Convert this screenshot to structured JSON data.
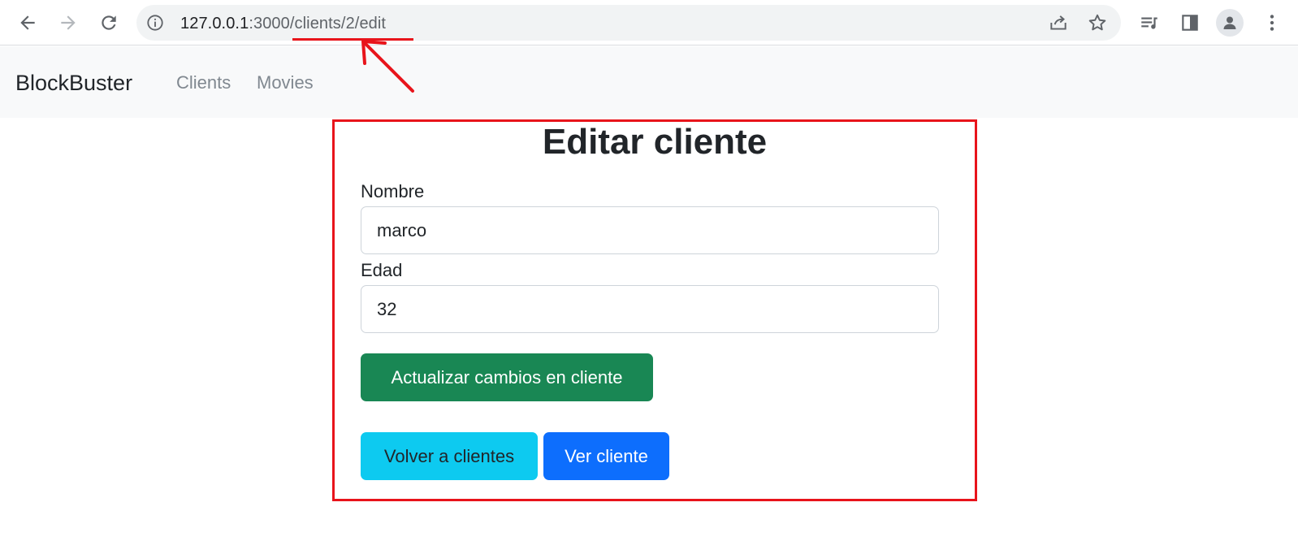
{
  "browser": {
    "url_host": "127.0.0.1",
    "url_rest": ":3000/clients/2/edit"
  },
  "navbar": {
    "brand": "BlockBuster",
    "links": [
      "Clients",
      "Movies"
    ]
  },
  "form": {
    "title": "Editar cliente",
    "nombre_label": "Nombre",
    "nombre_value": "marco",
    "edad_label": "Edad",
    "edad_value": "32",
    "submit_label": "Actualizar cambios en cliente",
    "back_label": "Volver a clientes",
    "view_label": "Ver cliente"
  },
  "colors": {
    "annotation": "#e8141b",
    "success": "#198754",
    "info": "#0dcaf0",
    "primary": "#0d6efd"
  },
  "icons": [
    "back-arrow-icon",
    "forward-arrow-icon",
    "reload-icon",
    "info-icon",
    "share-icon",
    "star-icon",
    "reading-list-icon",
    "side-panel-icon",
    "profile-icon",
    "more-vert-icon"
  ]
}
